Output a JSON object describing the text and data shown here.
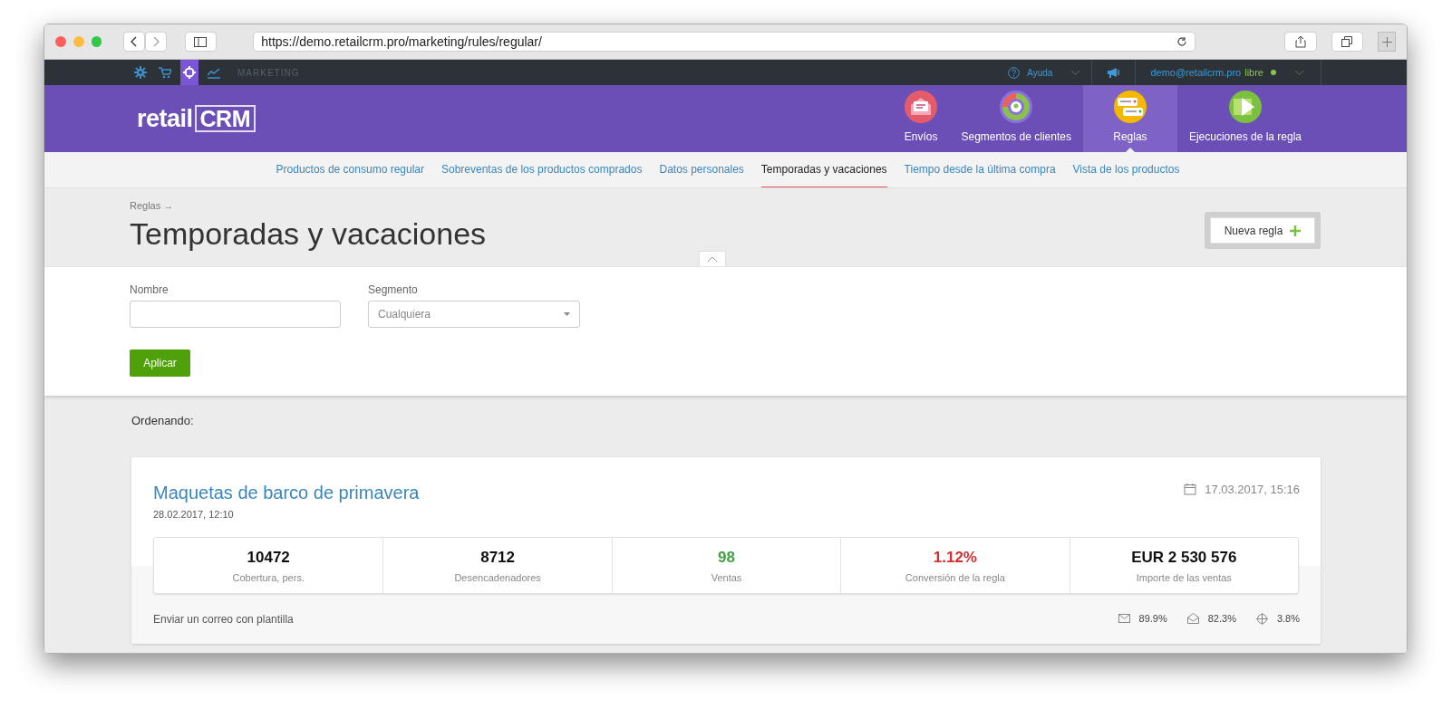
{
  "browser": {
    "url": "https://demo.retailcrm.pro/marketing/rules/regular/"
  },
  "topbar": {
    "modules": [
      {
        "kind": "gear",
        "selected": false
      },
      {
        "kind": "cart",
        "selected": false
      },
      {
        "kind": "target",
        "selected": true
      },
      {
        "kind": "chart",
        "selected": false
      }
    ],
    "section": "MARKETING",
    "help": "Ayuda",
    "user": "demo@retailcrm.pro",
    "plan": "libre"
  },
  "logo": {
    "word": "retail",
    "mark": "CRM"
  },
  "main_nav": [
    {
      "label": "Envíos",
      "kind": "mail",
      "selected": false
    },
    {
      "label": "Segmentos de clientes",
      "kind": "segments",
      "selected": false
    },
    {
      "label": "Reglas",
      "kind": "rules",
      "selected": true
    },
    {
      "label": "Ejecuciones de la regla",
      "kind": "play",
      "selected": false
    }
  ],
  "sub_nav": [
    {
      "label": "Productos de consumo regular",
      "selected": false
    },
    {
      "label": "Sobreventas de los productos comprados",
      "selected": false
    },
    {
      "label": "Datos personales",
      "selected": false
    },
    {
      "label": "Temporadas y vacaciones",
      "selected": true
    },
    {
      "label": "Tiempo desde la última compra",
      "selected": false
    },
    {
      "label": "Vista de los productos",
      "selected": false
    }
  ],
  "breadcrumb": "Reglas →",
  "title": "Temporadas y vacaciones",
  "new_button": "Nueva regla",
  "filters": {
    "name_label": "Nombre",
    "segment_label": "Segmento",
    "segment_value": "Cualquiera",
    "apply": "Aplicar"
  },
  "sorting": "Ordenando:",
  "rule": {
    "name": "Maquetas de barco de primavera",
    "created": "28.02.2017, 12:10",
    "date": "17.03.2017, 15:16",
    "stats": [
      {
        "value": "10472",
        "label": "Cobertura, pers.",
        "color": "#111111"
      },
      {
        "value": "8712",
        "label": "Desencadenadores",
        "color": "#111111"
      },
      {
        "value": "98",
        "label": "Ventas",
        "color": "#43a047"
      },
      {
        "value": "1.12%",
        "label": "Conversión de la regla",
        "color": "#d32f2f"
      },
      {
        "value": "EUR 2 530 576",
        "label": "Importe de las ventas",
        "color": "#111111"
      }
    ],
    "action": "Enviar un correo con plantilla",
    "metrics": [
      {
        "kind": "sent",
        "value": "89.9%"
      },
      {
        "kind": "opened",
        "value": "82.3%"
      },
      {
        "kind": "clicked",
        "value": "3.8%"
      }
    ]
  }
}
